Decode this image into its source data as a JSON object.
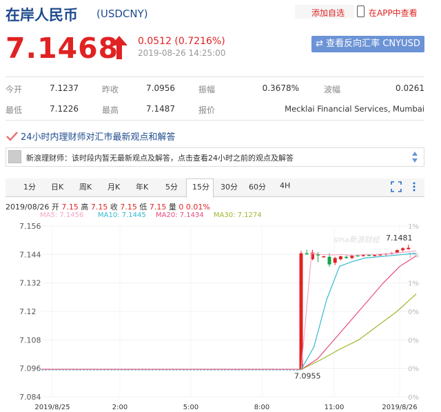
{
  "header": {
    "title": "在岸人民币",
    "code": "(USDCNY)",
    "add_fav": "添加自选",
    "app_view": "在APP中查看"
  },
  "quote": {
    "price": "7.1468",
    "change": "0.0512 (0.7216%)",
    "time": "2019-08-26 14:25:00",
    "reverse_btn": "⇄ 查看反向汇率 CNYUSD"
  },
  "stats": {
    "row1": [
      {
        "label": "今开",
        "value": "7.1237"
      },
      {
        "label": "昨收",
        "value": "7.0956"
      },
      {
        "label": "振幅",
        "value": "0.3678%"
      },
      {
        "label": "波幅",
        "value": "0.0261"
      }
    ],
    "row2": [
      {
        "label": "最低",
        "value": "7.1226"
      },
      {
        "label": "最高",
        "value": "7.1487"
      },
      {
        "label": "报价",
        "value": "Mecklai Financial Services, Mumbai"
      }
    ]
  },
  "news": {
    "heading": "24小时内理财师对汇市最新观点和解答",
    "item": "新浪理财师：该时段内暂无最新观点及解答，点击查看24小时之前的观点及解答"
  },
  "tabs": [
    "1分",
    "日K",
    "周K",
    "月K",
    "年K",
    "5分",
    "15分",
    "30分",
    "60分",
    "4H"
  ],
  "active_tab": "15分",
  "info_bar": {
    "date": "2019/08/26",
    "open_label": "开",
    "open": "7.15",
    "high_label": "高",
    "high": "7.15",
    "close_label": "收",
    "close": "7.15",
    "low_label": "低",
    "low": "7.15",
    "vol_label": "量",
    "vol": "0",
    "pct": "0.01%"
  },
  "ma_legend": [
    {
      "label": "MA5: 7.1456",
      "color": "#f4a6c6"
    },
    {
      "label": "MA10: 7.1445",
      "color": "#30b8d0"
    },
    {
      "label": "MA20: 7.1434",
      "color": "#e84a7a"
    },
    {
      "label": "MA30: 7.1274",
      "color": "#9ab82c"
    }
  ],
  "colors": {
    "up": "#e02222",
    "down": "#17a34a",
    "brand": "#1e4b8e"
  },
  "watermark": "sina新浪财经",
  "chart_data": {
    "type": "candlestick",
    "y_ticks": [
      "7.156",
      "7.144",
      "7.132",
      "7.12",
      "7.108",
      "7.096",
      "7.084"
    ],
    "pct_ticks": [
      "1%",
      "1%",
      "1%",
      "0%",
      "0%",
      "0%",
      "0%"
    ],
    "x_ticks": [
      "2019/8/25",
      "2:00",
      "5:00",
      "8:00",
      "11:00",
      "2019/8/26"
    ],
    "ylim": [
      7.084,
      7.156
    ],
    "max_label": "7.1481",
    "min_label": "7.0955",
    "baseline": 7.0956,
    "candles": [
      {
        "o": 7.0955,
        "h": 7.1455,
        "l": 7.0955,
        "c": 7.1445
      },
      {
        "o": 7.1445,
        "h": 7.146,
        "l": 7.144,
        "c": 7.144
      },
      {
        "o": 7.142,
        "h": 7.146,
        "l": 7.1415,
        "c": 7.1448
      },
      {
        "o": 7.144,
        "h": 7.145,
        "l": 7.1408,
        "c": 7.1436
      },
      {
        "o": 7.143,
        "h": 7.1435,
        "l": 7.1428,
        "c": 7.1432
      },
      {
        "o": 7.143,
        "h": 7.1445,
        "l": 7.1388,
        "c": 7.1398
      },
      {
        "o": 7.1405,
        "h": 7.143,
        "l": 7.1395,
        "c": 7.1425
      },
      {
        "o": 7.142,
        "h": 7.1435,
        "l": 7.1415,
        "c": 7.1432
      },
      {
        "o": 7.143,
        "h": 7.1436,
        "l": 7.1422,
        "c": 7.1425
      },
      {
        "o": 7.1425,
        "h": 7.144,
        "l": 7.142,
        "c": 7.1436
      },
      {
        "o": 7.1436,
        "h": 7.144,
        "l": 7.1432,
        "c": 7.1434
      },
      {
        "o": 7.1434,
        "h": 7.1442,
        "l": 7.143,
        "c": 7.1438
      },
      {
        "o": 7.1438,
        "h": 7.144,
        "l": 7.1435,
        "c": 7.1436
      },
      {
        "o": 7.1436,
        "h": 7.144,
        "l": 7.1432,
        "c": 7.1438
      },
      {
        "o": 7.1438,
        "h": 7.1442,
        "l": 7.1435,
        "c": 7.144
      },
      {
        "o": 7.144,
        "h": 7.1446,
        "l": 7.1436,
        "c": 7.1444
      },
      {
        "o": 7.1444,
        "h": 7.145,
        "l": 7.144,
        "c": 7.1446
      },
      {
        "o": 7.1446,
        "h": 7.1462,
        "l": 7.1444,
        "c": 7.1458
      },
      {
        "o": 7.1458,
        "h": 7.147,
        "l": 7.1452,
        "c": 7.1466
      },
      {
        "o": 7.1462,
        "h": 7.1481,
        "l": 7.146,
        "c": 7.1468
      }
    ],
    "ma_lines": [
      {
        "name": "MA5",
        "points": [
          7.0955,
          7.1445,
          7.144,
          7.1438,
          7.144,
          7.1435,
          7.144,
          7.144,
          7.1442,
          7.1446,
          7.145,
          7.1456
        ]
      },
      {
        "name": "MA10",
        "points": [
          7.0955,
          7.105,
          7.125,
          7.139,
          7.141,
          7.1425,
          7.143,
          7.1435,
          7.144,
          7.1445
        ]
      },
      {
        "name": "MA20",
        "points": [
          7.0955,
          7.1,
          7.108,
          7.116,
          7.124,
          7.132,
          7.139,
          7.1434
        ]
      },
      {
        "name": "MA30",
        "points": [
          7.0955,
          7.0995,
          7.104,
          7.108,
          7.114,
          7.12,
          7.1274
        ]
      }
    ]
  }
}
